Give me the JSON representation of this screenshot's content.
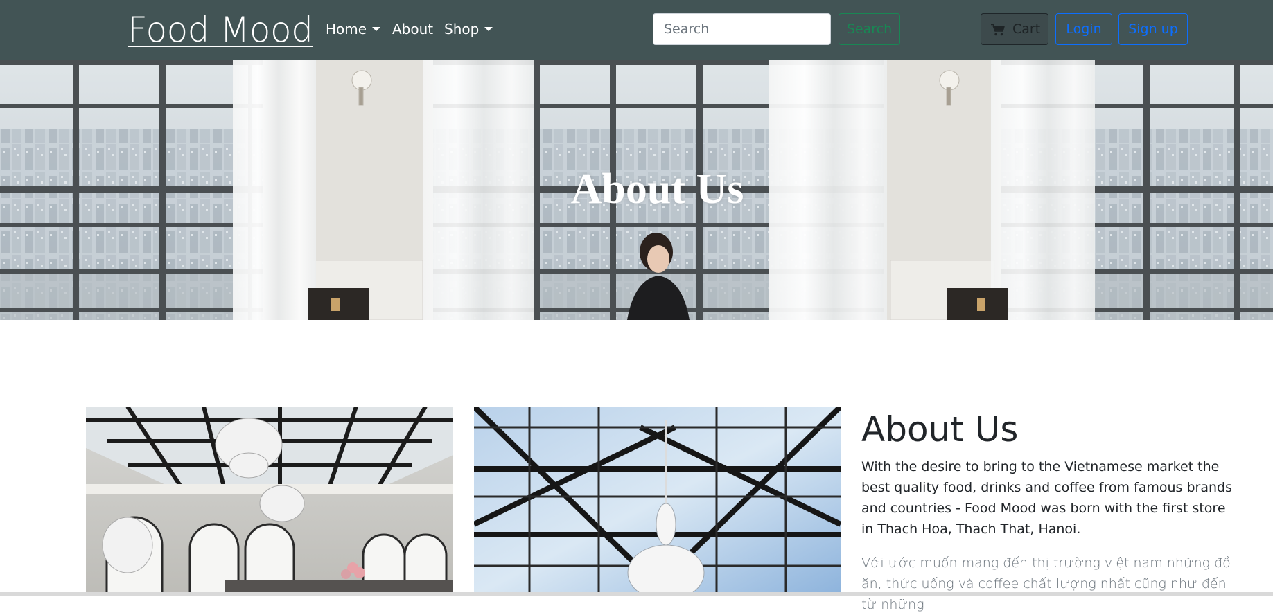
{
  "navbar": {
    "brand": "Food Mood",
    "items": [
      {
        "label": "Home",
        "has_dropdown": true
      },
      {
        "label": "About",
        "has_dropdown": false
      },
      {
        "label": "Shop",
        "has_dropdown": true
      }
    ],
    "search": {
      "placeholder": "Search",
      "value": "",
      "button_label": "Search"
    },
    "cart_label": "Cart",
    "login_label": "Login",
    "signup_label": "Sign up",
    "colors": {
      "background": "#425455",
      "search_button": "#198754",
      "auth_buttons": "#0d6efd"
    },
    "icons": [
      "chevron-down-icon",
      "cart-icon"
    ]
  },
  "hero": {
    "title": "About Us"
  },
  "about": {
    "heading": "About Us",
    "paragraph_en": "With the desire to bring to the Vietnamese market the best quality food, drinks and coffee from famous brands and countries - Food Mood was born with the first store in Thach Hoa, Thach That, Hanoi.",
    "paragraph_vi": "Với ước muốn mang đến thị trường việt nam những đồ ăn, thức uống và coffee chất lượng nhất cũng như đến từ những"
  }
}
